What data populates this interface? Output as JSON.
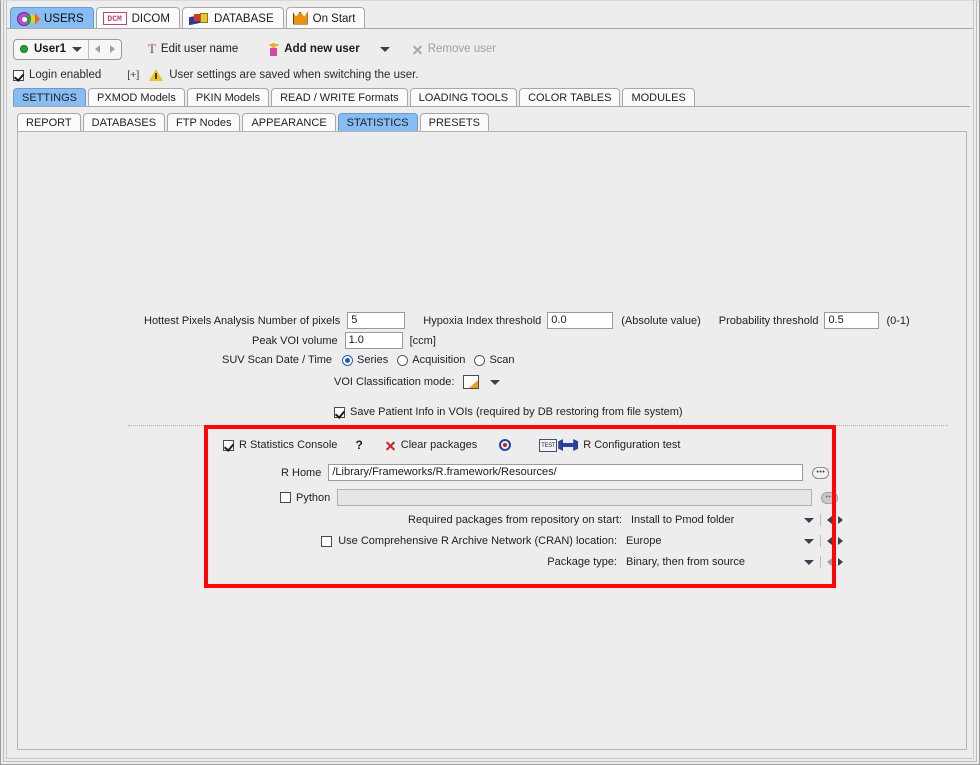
{
  "top_tabs": [
    {
      "label": "USERS",
      "icon": "users-icon",
      "active": true
    },
    {
      "label": "DICOM",
      "icon": "dcm-icon",
      "active": false
    },
    {
      "label": "DATABASE",
      "icon": "database-icon",
      "active": false
    },
    {
      "label": "On Start",
      "icon": "crown-icon",
      "active": false
    }
  ],
  "user_toolbar": {
    "user_name": "User1",
    "edit_user_label": "Edit user name",
    "edit_user_glyph": "T",
    "add_user_label": "Add new user",
    "remove_user_label": "Remove user"
  },
  "login_row": {
    "login_enabled_label": "Login enabled",
    "login_enabled_checked": true,
    "expand_marker": "[+]",
    "notice": "User settings are saved when switching the user."
  },
  "settings_tabs": [
    {
      "label": "SETTINGS",
      "active": true
    },
    {
      "label": "PXMOD Models",
      "active": false
    },
    {
      "label": "PKIN Models",
      "active": false
    },
    {
      "label": "READ / WRITE Formats",
      "active": false
    },
    {
      "label": "LOADING TOOLS",
      "active": false
    },
    {
      "label": "COLOR TABLES",
      "active": false
    },
    {
      "label": "MODULES",
      "active": false
    }
  ],
  "sub_tabs": [
    {
      "label": "REPORT",
      "active": false
    },
    {
      "label": "DATABASES",
      "active": false
    },
    {
      "label": "FTP Nodes",
      "active": false
    },
    {
      "label": "APPEARANCE",
      "active": false
    },
    {
      "label": "STATISTICS",
      "active": true
    },
    {
      "label": "PRESETS",
      "active": false
    }
  ],
  "statistics": {
    "hottest_pixels_label": "Hottest Pixels Analysis Number of pixels",
    "hottest_pixels_value": "5",
    "hypoxia_label": "Hypoxia Index threshold",
    "hypoxia_value": "0.0",
    "hypoxia_suffix": "(Absolute value)",
    "probability_label": "Probability threshold",
    "probability_value": "0.5",
    "probability_suffix": "(0-1)",
    "peak_voi_label": "Peak VOI volume",
    "peak_voi_value": "1.0",
    "peak_voi_units": "[ccm]",
    "suv_label": "SUV Scan Date / Time",
    "suv_options": [
      {
        "label": "Series",
        "selected": true
      },
      {
        "label": "Acquisition",
        "selected": false
      },
      {
        "label": "Scan",
        "selected": false
      }
    ],
    "voi_mode_label": "VOI Classification mode:",
    "save_patient_info_label": "Save Patient Info in VOIs (required by DB restoring from file system)",
    "save_patient_info_checked": true
  },
  "r_section": {
    "console_label": "R Statistics Console",
    "console_checked": true,
    "help_glyph": "?",
    "clear_packages_label": "Clear packages",
    "config_test_label": "R Configuration test",
    "test_icon_text": "TEST",
    "r_home_label": "R Home",
    "r_home_value": "/Library/Frameworks/R.framework/Resources/",
    "python_label": "Python",
    "python_checked": false,
    "python_value": "",
    "browse_glyph": "•••",
    "rows": [
      {
        "label": "Required packages from repository on start:",
        "value": "Install to Pmod folder",
        "has_checkbox": false,
        "checked": false,
        "prev_enabled": true
      },
      {
        "label": "Use Comprehensive R Archive Network (CRAN) location:",
        "value": "Europe",
        "has_checkbox": true,
        "checked": false,
        "prev_enabled": true
      },
      {
        "label": "Package type:",
        "value": "Binary, then from source",
        "has_checkbox": false,
        "checked": false,
        "prev_enabled": false
      }
    ]
  },
  "colors": {
    "highlight": "#fb0707",
    "tab_active": "#87bdf4",
    "panel_bg": "#ededed",
    "accent_red": "#cf2222"
  }
}
